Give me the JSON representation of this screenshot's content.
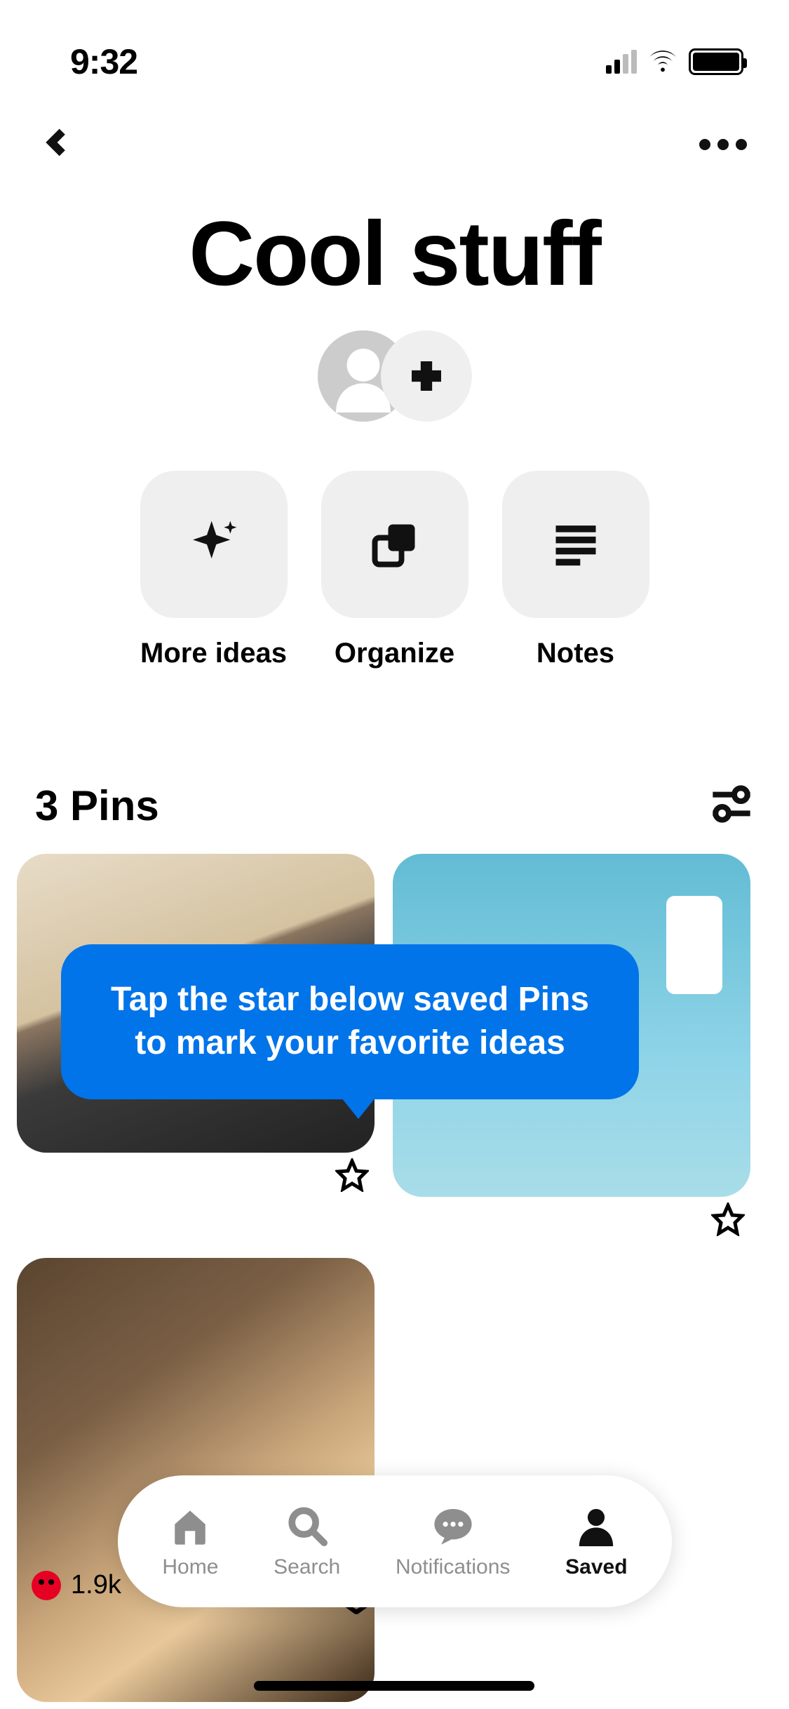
{
  "status": {
    "time": "9:32"
  },
  "board": {
    "title": "Cool stuff",
    "pins_count": "3 Pins",
    "actions": [
      {
        "label": "More ideas"
      },
      {
        "label": "Organize"
      },
      {
        "label": "Notes"
      }
    ]
  },
  "tooltip": {
    "text": "Tap the star below saved Pins to mark your favorite ideas"
  },
  "reaction": {
    "count": "1.9k"
  },
  "nav": {
    "items": [
      {
        "label": "Home"
      },
      {
        "label": "Search"
      },
      {
        "label": "Notifications"
      },
      {
        "label": "Saved"
      }
    ]
  }
}
